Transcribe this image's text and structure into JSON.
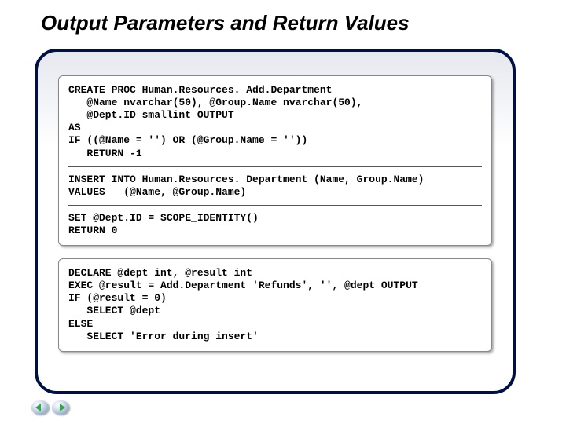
{
  "title": "Output Parameters and Return Values",
  "card1": {
    "block1": "CREATE PROC Human.Resources. Add.Department\n   @Name nvarchar(50), @Group.Name nvarchar(50),\n   @Dept.ID smallint OUTPUT\nAS\nIF ((@Name = '') OR (@Group.Name = ''))\n   RETURN -1",
    "block2": "INSERT INTO Human.Resources. Department (Name, Group.Name)\nVALUES   (@Name, @Group.Name)",
    "block3": "SET @Dept.ID = SCOPE_IDENTITY()\nRETURN 0"
  },
  "card2": {
    "block1": "DECLARE @dept int, @result int\nEXEC @result = Add.Department 'Refunds', '', @dept OUTPUT\nIF (@result = 0)\n   SELECT @dept\nELSE\n   SELECT 'Error during insert'"
  },
  "nav": {
    "prev": "prev-slide",
    "next": "next-slide"
  }
}
